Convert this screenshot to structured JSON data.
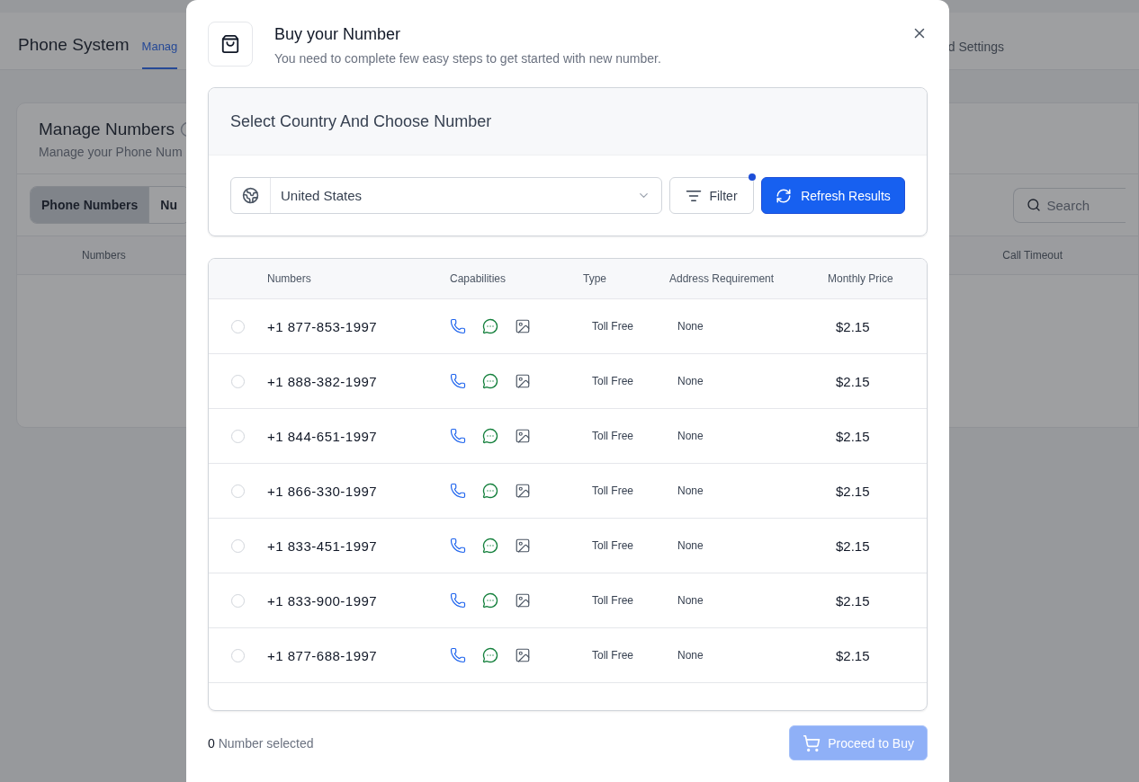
{
  "background": {
    "app_title": "Phone System",
    "nav_tabs": [
      {
        "label": "Manag",
        "selected": true
      }
    ],
    "nav_right": "d Settings",
    "card": {
      "title": "Manage Numbers",
      "subtitle": "Manage your Phone Num",
      "tabs": [
        {
          "label": "Phone Numbers",
          "selected": true
        },
        {
          "label": "Nu",
          "selected": false
        }
      ],
      "search": {
        "placeholder": "Search"
      },
      "columns": [
        "Numbers",
        "Call Timeout"
      ]
    }
  },
  "dialog": {
    "title": "Buy your Number",
    "subtitle": "You need to complete few easy steps to get started with new number.",
    "section_title": "Select Country And Choose Number",
    "country": "United States",
    "filter": {
      "label": "Filter",
      "active": true
    },
    "refresh": "Refresh Results",
    "table": {
      "columns": [
        "Numbers",
        "Capabilities",
        "Type",
        "Address Requirement",
        "Monthly Price"
      ],
      "rows": [
        {
          "number": "+1 877-853-1997",
          "type": "Toll Free",
          "address": "None",
          "price": "$2.15",
          "selected": false
        },
        {
          "number": "+1 888-382-1997",
          "type": "Toll Free",
          "address": "None",
          "price": "$2.15",
          "selected": false
        },
        {
          "number": "+1 844-651-1997",
          "type": "Toll Free",
          "address": "None",
          "price": "$2.15",
          "selected": false
        },
        {
          "number": "+1 866-330-1997",
          "type": "Toll Free",
          "address": "None",
          "price": "$2.15",
          "selected": false
        },
        {
          "number": "+1 833-451-1997",
          "type": "Toll Free",
          "address": "None",
          "price": "$2.15",
          "selected": false
        },
        {
          "number": "+1 833-900-1997",
          "type": "Toll Free",
          "address": "None",
          "price": "$2.15",
          "selected": false
        },
        {
          "number": "+1 877-688-1997",
          "type": "Toll Free",
          "address": "None",
          "price": "$2.15",
          "selected": false
        }
      ]
    },
    "selection_count": "**0** Number selected",
    "buy_button": {
      "label": "Proceed to Buy",
      "disabled": true
    }
  }
}
